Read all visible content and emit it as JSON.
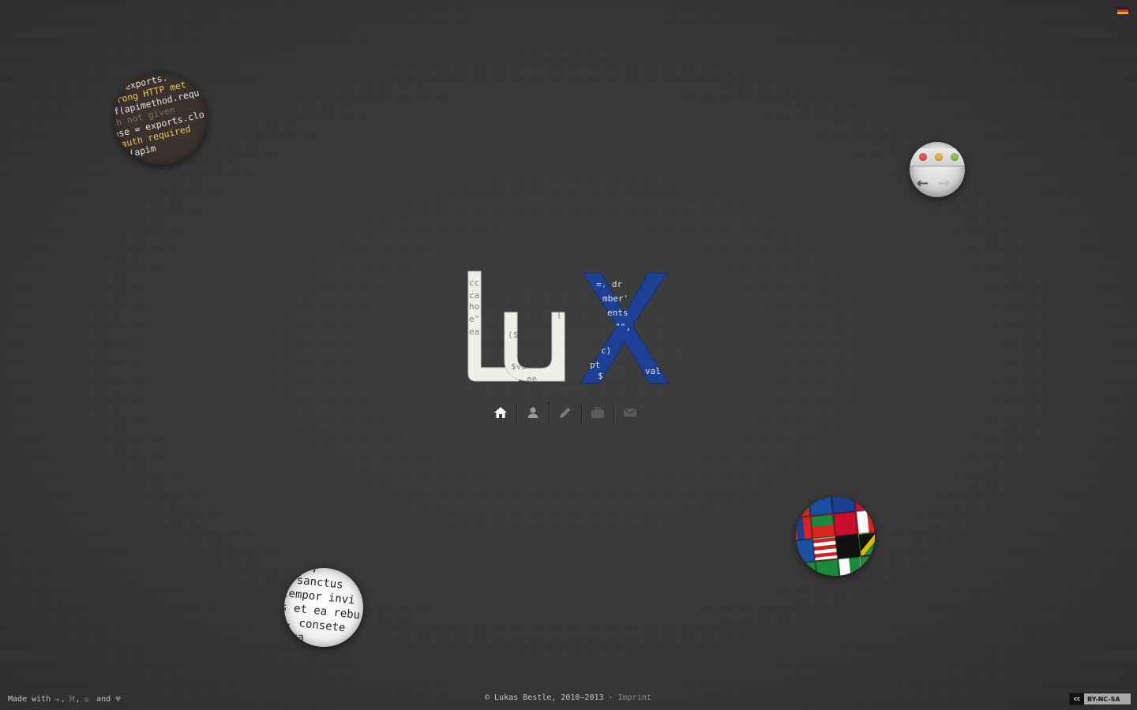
{
  "language": {
    "flag_icon": "german-flag-icon"
  },
  "bubbles": {
    "code": {
      "lines": [
        {
          "text": "s = exports.",
          "color": "w"
        },
        {
          "text": "\"wrong HTTP met",
          "color": "y"
        },
        {
          "text": "if(apimethod.requ",
          "color": "w"
        },
        {
          "text": "th not given",
          "color": "d"
        },
        {
          "text": "nse = exports.clo",
          "color": "w"
        },
        {
          "text": "\"auth required",
          "color": "y"
        },
        {
          "text": "  (apim",
          "color": "w"
        }
      ]
    },
    "text": {
      "lines": [
        "erat,",
        "a sanctus",
        "tempor invi",
        "s et ea rebu",
        "t, consete",
        "ntua"
      ]
    }
  },
  "logo": {
    "text_left": "lu",
    "text_right": "X",
    "left_color": "#eeeeea",
    "right_color": "#1d3f96"
  },
  "nav": {
    "items": [
      {
        "name": "home",
        "icon": "home-icon",
        "color": "#ffffff"
      },
      {
        "name": "about",
        "icon": "user-icon",
        "color": "#9a9a9a"
      },
      {
        "name": "blog",
        "icon": "pencil-icon",
        "color": "#7a7a7a"
      },
      {
        "name": "portfolio",
        "icon": "briefcase-icon",
        "color": "#5c5c5c"
      },
      {
        "name": "contact",
        "icon": "envelope-icon",
        "color": "#5c5c5c"
      }
    ]
  },
  "footer": {
    "made_with": "Made with",
    "comma": ",",
    "and": "and",
    "made_with_icons": [
      "leaf-icon",
      "markdown-icon",
      "gear-icon",
      "heart-icon"
    ],
    "copyright": "© Lukas Bestle, 2010–2013",
    "separator": "·",
    "imprint": "Imprint",
    "license": "BY-NC-SA",
    "license_icon": "cc"
  }
}
